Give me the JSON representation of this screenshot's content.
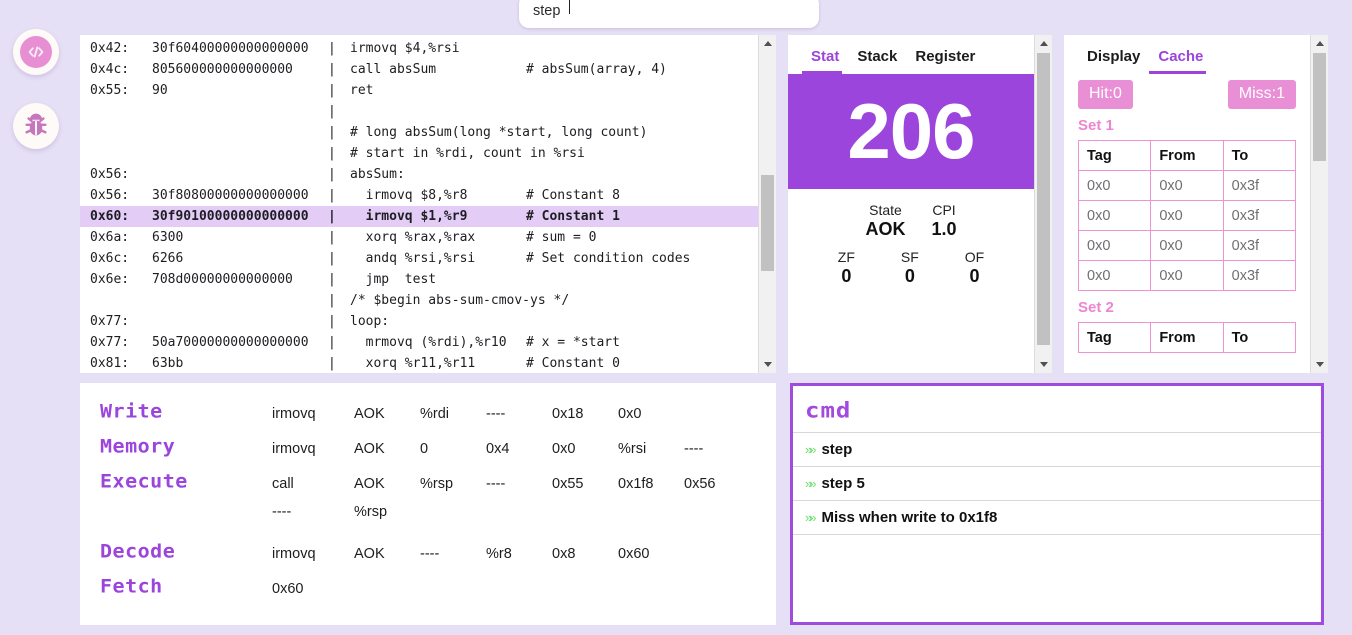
{
  "app": {
    "background_color": "#e6e0f6",
    "accent_purple": "#9b45dd",
    "accent_pink": "#e98fd5",
    "highlight_line_color": "#e3cdf6"
  },
  "search": {
    "value": "step",
    "placeholder": "step"
  },
  "rail": {
    "items": [
      {
        "name": "code-icon",
        "label": "Code"
      },
      {
        "name": "bug-icon",
        "label": "Debug"
      }
    ]
  },
  "code": {
    "lines": [
      {
        "addr": "0x42:",
        "bytes": "30f60400000000000000",
        "pipe": "|",
        "asm": "irmovq $4,%rsi",
        "comment": "",
        "highlight": false
      },
      {
        "addr": "0x4c:",
        "bytes": "805600000000000000",
        "pipe": "|",
        "asm": "call absSum",
        "comment": "# absSum(array, 4)",
        "highlight": false
      },
      {
        "addr": "0x55:",
        "bytes": "90",
        "pipe": "|",
        "asm": "ret",
        "comment": "",
        "highlight": false
      },
      {
        "addr": "",
        "bytes": "",
        "pipe": "|",
        "asm": "",
        "comment": "",
        "highlight": false
      },
      {
        "addr": "",
        "bytes": "",
        "pipe": "|",
        "asm": "# long absSum(long *start, long count)",
        "comment": "",
        "highlight": false,
        "wide": true
      },
      {
        "addr": "",
        "bytes": "",
        "pipe": "|",
        "asm": "# start in %rdi, count in %rsi",
        "comment": "",
        "highlight": false,
        "wide": true
      },
      {
        "addr": "0x56:",
        "bytes": "",
        "pipe": "|",
        "asm": "absSum:",
        "comment": "",
        "highlight": false,
        "wide": true
      },
      {
        "addr": "0x56:",
        "bytes": "30f80800000000000000",
        "pipe": "|",
        "asm": "  irmovq $8,%r8",
        "comment": "# Constant 8",
        "highlight": false
      },
      {
        "addr": "0x60:",
        "bytes": "30f90100000000000000",
        "pipe": "|",
        "asm": "  irmovq $1,%r9",
        "comment": "# Constant 1",
        "highlight": true
      },
      {
        "addr": "0x6a:",
        "bytes": "6300",
        "pipe": "|",
        "asm": "  xorq %rax,%rax",
        "comment": "# sum = 0",
        "highlight": false
      },
      {
        "addr": "0x6c:",
        "bytes": "6266",
        "pipe": "|",
        "asm": "  andq %rsi,%rsi",
        "comment": "# Set condition codes",
        "highlight": false
      },
      {
        "addr": "0x6e:",
        "bytes": "708d00000000000000",
        "pipe": "|",
        "asm": "  jmp  test",
        "comment": "",
        "highlight": false
      },
      {
        "addr": "",
        "bytes": "",
        "pipe": "|",
        "asm": "/* $begin abs-sum-cmov-ys */",
        "comment": "",
        "highlight": false,
        "wide": true
      },
      {
        "addr": "0x77:",
        "bytes": "",
        "pipe": "|",
        "asm": "loop:",
        "comment": "",
        "highlight": false,
        "wide": true
      },
      {
        "addr": "0x77:",
        "bytes": "50a70000000000000000",
        "pipe": "|",
        "asm": "  mrmovq (%rdi),%r10",
        "comment": "# x = *start",
        "highlight": false
      },
      {
        "addr": "0x81:",
        "bytes": "63bb",
        "pipe": "|",
        "asm": "  xorq %r11,%r11",
        "comment": "# Constant 0",
        "highlight": false
      }
    ]
  },
  "stat": {
    "tabs": [
      {
        "label": "Stat",
        "active": true
      },
      {
        "label": "Stack",
        "active": false
      },
      {
        "label": "Register",
        "active": false
      }
    ],
    "cycle_count": "206",
    "metrics": [
      {
        "key": "State",
        "value": "AOK"
      },
      {
        "key": "CPI",
        "value": "1.0"
      }
    ],
    "flags": [
      {
        "key": "ZF",
        "value": "0"
      },
      {
        "key": "SF",
        "value": "0"
      },
      {
        "key": "OF",
        "value": "0"
      }
    ]
  },
  "cache": {
    "tabs": [
      {
        "label": "Display",
        "active": false
      },
      {
        "label": "Cache",
        "active": true
      }
    ],
    "hit_badge": "Hit:0",
    "miss_badge": "Miss:1",
    "sets": [
      {
        "label": "Set 1",
        "headers": [
          "Tag",
          "From",
          "To"
        ],
        "rows": [
          [
            "0x0",
            "0x0",
            "0x3f"
          ],
          [
            "0x0",
            "0x0",
            "0x3f"
          ],
          [
            "0x0",
            "0x0",
            "0x3f"
          ],
          [
            "0x0",
            "0x0",
            "0x3f"
          ]
        ]
      },
      {
        "label": "Set 2",
        "headers": [
          "Tag",
          "From",
          "To"
        ],
        "rows": []
      }
    ]
  },
  "pipeline": {
    "stages": [
      {
        "name": "Write",
        "cells": [
          "irmovq",
          "AOK",
          "%rdi",
          "----",
          "0x18",
          "0x0",
          ""
        ]
      },
      {
        "name": "Memory",
        "cells": [
          "irmovq",
          "AOK",
          "0",
          "0x4",
          "0x0",
          "%rsi",
          "----"
        ]
      },
      {
        "name": "Execute",
        "cells": [
          "call",
          "AOK",
          "%rsp",
          "----",
          "0x55",
          "0x1f8",
          "0x56"
        ]
      },
      {
        "name": "",
        "cells": [
          "----",
          "%rsp",
          "",
          "",
          "",
          "",
          ""
        ]
      },
      {
        "name": "Decode",
        "cells": [
          "irmovq",
          "AOK",
          "----",
          "%r8",
          "0x8",
          "0x60",
          ""
        ]
      },
      {
        "name": "Fetch",
        "cells": [
          "0x60",
          "",
          "",
          "",
          "",
          "",
          ""
        ]
      }
    ]
  },
  "cmd": {
    "title": "cmd",
    "prompt_glyph": "»›",
    "entries": [
      {
        "text": "step"
      },
      {
        "text": "step 5"
      },
      {
        "text": "Miss when write to 0x1f8"
      }
    ]
  }
}
